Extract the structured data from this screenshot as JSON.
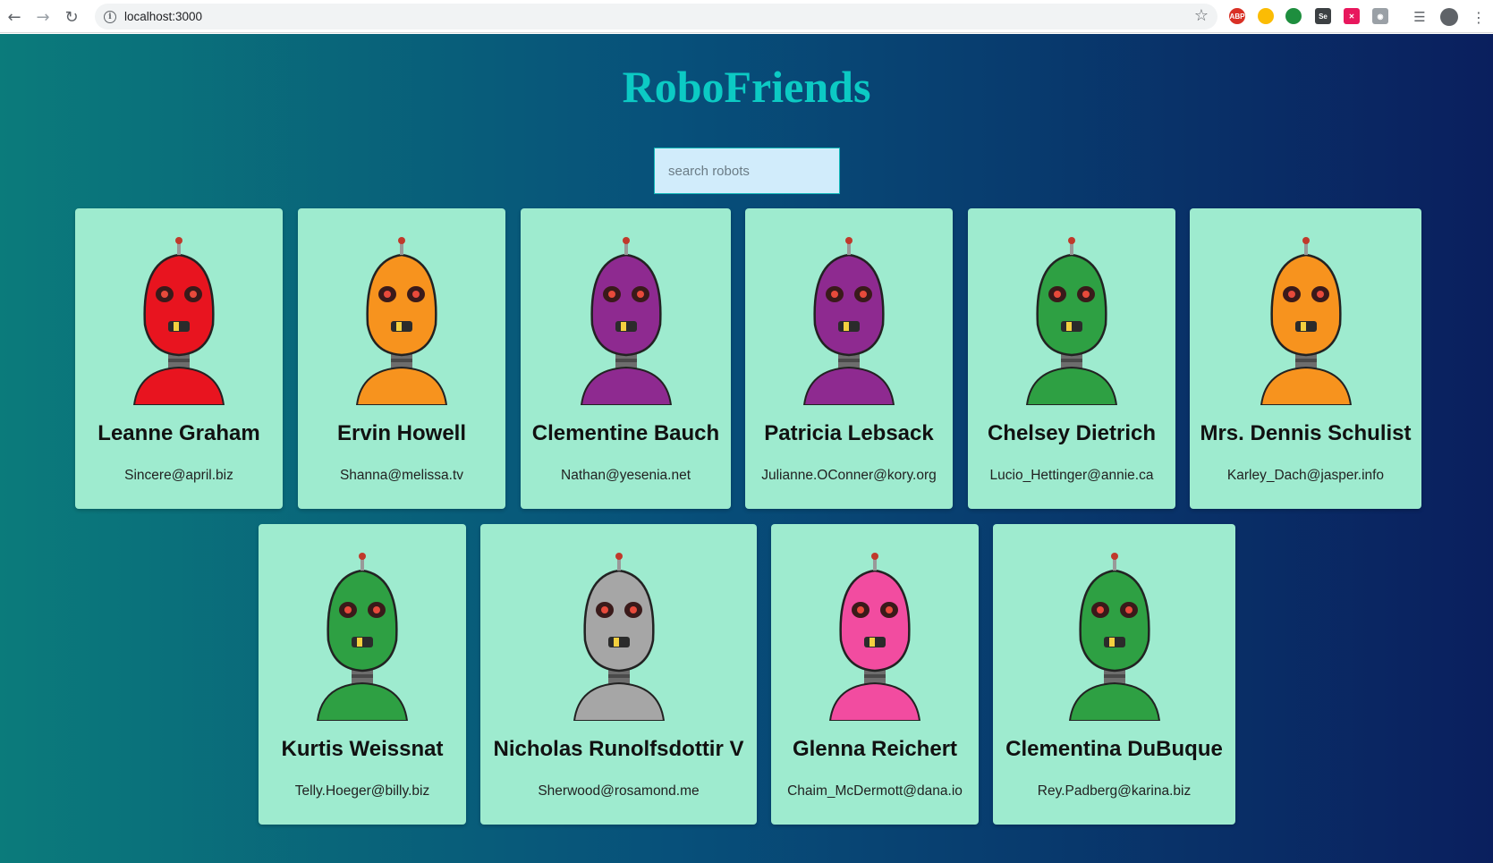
{
  "browser": {
    "url": "localhost:3000",
    "extensions": [
      "adblock-icon",
      "chrome-ext-icon",
      "clover-icon",
      "selenium-icon",
      "ext-red-icon",
      "camera-icon"
    ]
  },
  "app": {
    "title": "RoboFriends",
    "search_placeholder": "search robots"
  },
  "robots": [
    {
      "name": "Leanne Graham",
      "email": "Sincere@april.biz",
      "color": "#e8141f"
    },
    {
      "name": "Ervin Howell",
      "email": "Shanna@melissa.tv",
      "color": "#f7931e"
    },
    {
      "name": "Clementine Bauch",
      "email": "Nathan@yesenia.net",
      "color": "#8e2a90"
    },
    {
      "name": "Patricia Lebsack",
      "email": "Julianne.OConner@kory.org",
      "color": "#8e2a90"
    },
    {
      "name": "Chelsey Dietrich",
      "email": "Lucio_Hettinger@annie.ca",
      "color": "#2ea043"
    },
    {
      "name": "Mrs. Dennis Schulist",
      "email": "Karley_Dach@jasper.info",
      "color": "#f7931e"
    },
    {
      "name": "Kurtis Weissnat",
      "email": "Telly.Hoeger@billy.biz",
      "color": "#2ea043"
    },
    {
      "name": "Nicholas Runolfsdottir V",
      "email": "Sherwood@rosamond.me",
      "color": "#a6a6a6"
    },
    {
      "name": "Glenna Reichert",
      "email": "Chaim_McDermott@dana.io",
      "color": "#f24ca0"
    },
    {
      "name": "Clementina DuBuque",
      "email": "Rey.Padberg@karina.biz",
      "color": "#2ea043"
    }
  ]
}
